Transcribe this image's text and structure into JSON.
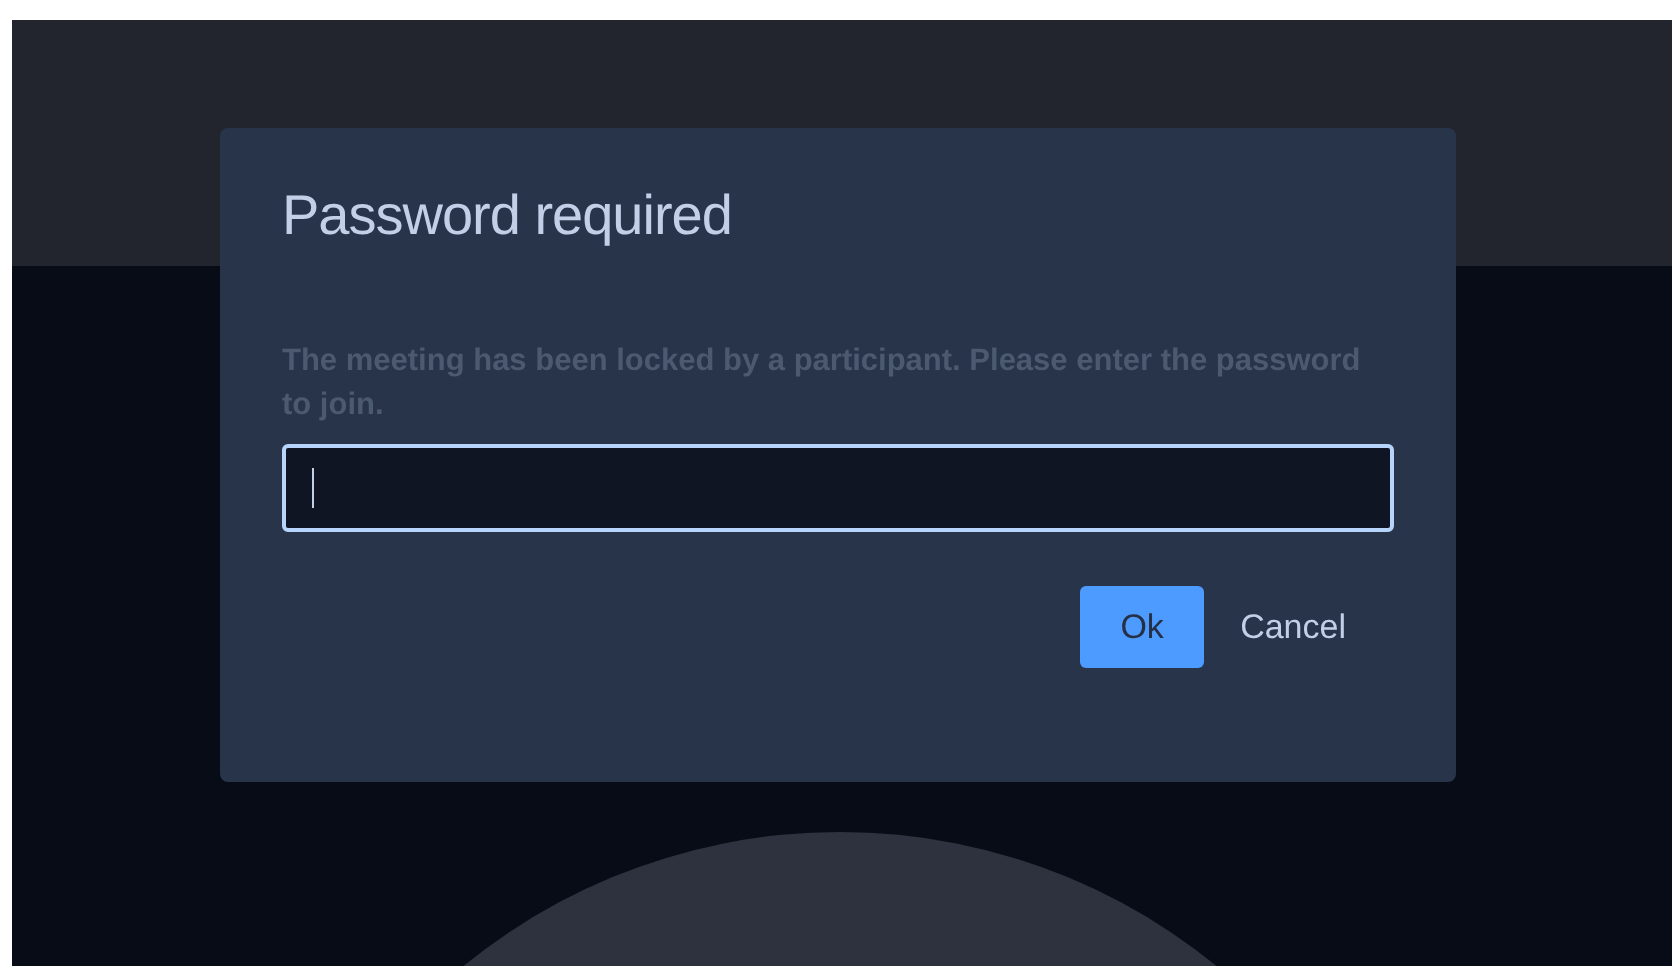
{
  "dialog": {
    "title": "Password required",
    "message": "The meeting has been locked by a participant. Please enter the password to join.",
    "password_field": {
      "focused": true
    },
    "buttons": [
      {
        "label": "Ok",
        "kind": "primary"
      },
      {
        "label": "Cancel",
        "kind": "plain"
      }
    ]
  }
}
